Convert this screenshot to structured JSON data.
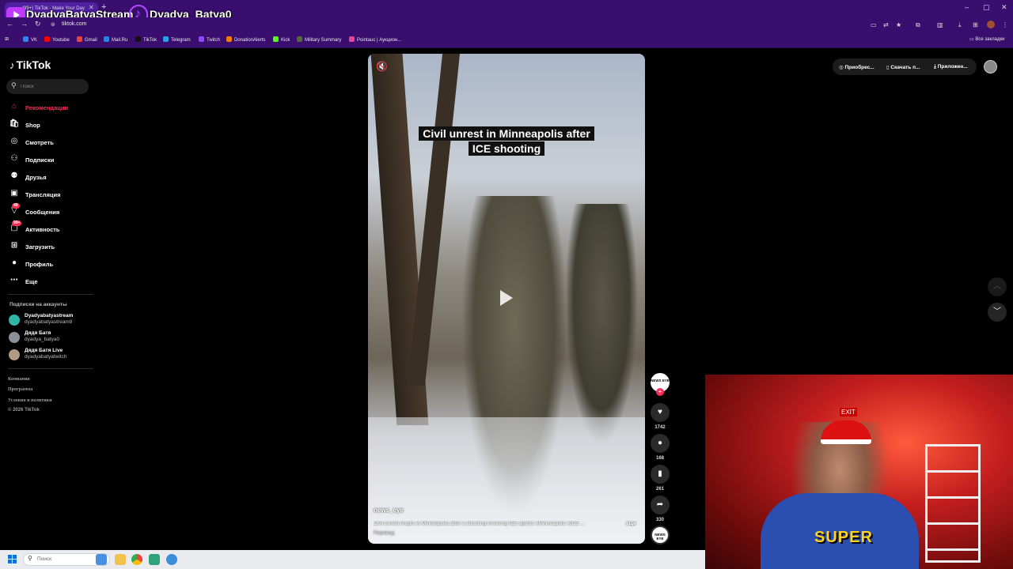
{
  "browser": {
    "tab_title": "(99+) TikTok - Make Your Day",
    "url": "tiktok.com",
    "bookmarks": [
      {
        "label": "VK",
        "color": "#2787f5"
      },
      {
        "label": "Youtube",
        "color": "#ff0000"
      },
      {
        "label": "Gmail",
        "color": "#ea4335"
      },
      {
        "label": "Mail.Ru",
        "color": "#168de2"
      },
      {
        "label": "TikTok",
        "color": "#111111"
      },
      {
        "label": "Telegram",
        "color": "#2aa3e6"
      },
      {
        "label": "Twitch",
        "color": "#9146ff"
      },
      {
        "label": "DonationAlerts",
        "color": "#f57d07"
      },
      {
        "label": "Kick",
        "color": "#53fc18"
      },
      {
        "label": "Military Summary",
        "color": "#556b2f"
      },
      {
        "label": "Pointauc | Аукцион...",
        "color": "#e84393"
      }
    ],
    "all_bookmarks": "Все закладки"
  },
  "stream_overlay": {
    "left_title": "DyadyaBatyaStream",
    "right_title": "Dyadya_Batya0"
  },
  "sidebar": {
    "brand": "TikTok",
    "search_placeholder": "Поиск",
    "nav": [
      {
        "label": "Рекомендации",
        "icon": "home-icon",
        "active": true
      },
      {
        "label": "Shop",
        "icon": "shop-icon"
      },
      {
        "label": "Смотреть",
        "icon": "explore-icon"
      },
      {
        "label": "Подписки",
        "icon": "following-icon"
      },
      {
        "label": "Друзья",
        "icon": "friends-icon"
      },
      {
        "label": "Трансляция",
        "icon": "live-icon"
      },
      {
        "label": "Сообщения",
        "icon": "messages-icon",
        "badge": "49"
      },
      {
        "label": "Активность",
        "icon": "activity-icon",
        "badge": "99+"
      },
      {
        "label": "Загрузить",
        "icon": "upload-icon"
      },
      {
        "label": "Профиль",
        "icon": "profile-icon"
      },
      {
        "label": "Еще",
        "icon": "more-icon"
      }
    ],
    "following_title": "Подписки на аккаунты",
    "accounts": [
      {
        "name": "Dyadyabatyastream",
        "handle": "dyadyabatyastream8"
      },
      {
        "name": "Дядя Батя",
        "handle": "dyadya_batya0"
      },
      {
        "name": "Дядя Батя Live",
        "handle": "dyadyabatyatwitch"
      }
    ],
    "footer": [
      "Компания",
      "Программа",
      "Условия и политики",
      "© 2026 TikTok"
    ]
  },
  "video": {
    "caption_line1": "Civil unrest in Minneapolis after",
    "caption_line2": "ICE shooting",
    "author": "news_eye",
    "description": "Civil unrest erupts in Minneapolis after a shooting involving ICE agents #Minneapolis #ICE ...",
    "more": "еще",
    "translate": "Перевод",
    "author_avatar_text": "NEWS EYE"
  },
  "actions": {
    "likes": "1742",
    "comments": "168",
    "saves": "261",
    "shares": "330"
  },
  "topbar": {
    "get_coins": "Приобрес...",
    "download": "Скачать п...",
    "app": "Приложен..."
  },
  "taskbar": {
    "search_placeholder": "Поиск"
  },
  "webcam": {
    "shirt_text": "SUPER",
    "sign_text": "EXIT"
  }
}
